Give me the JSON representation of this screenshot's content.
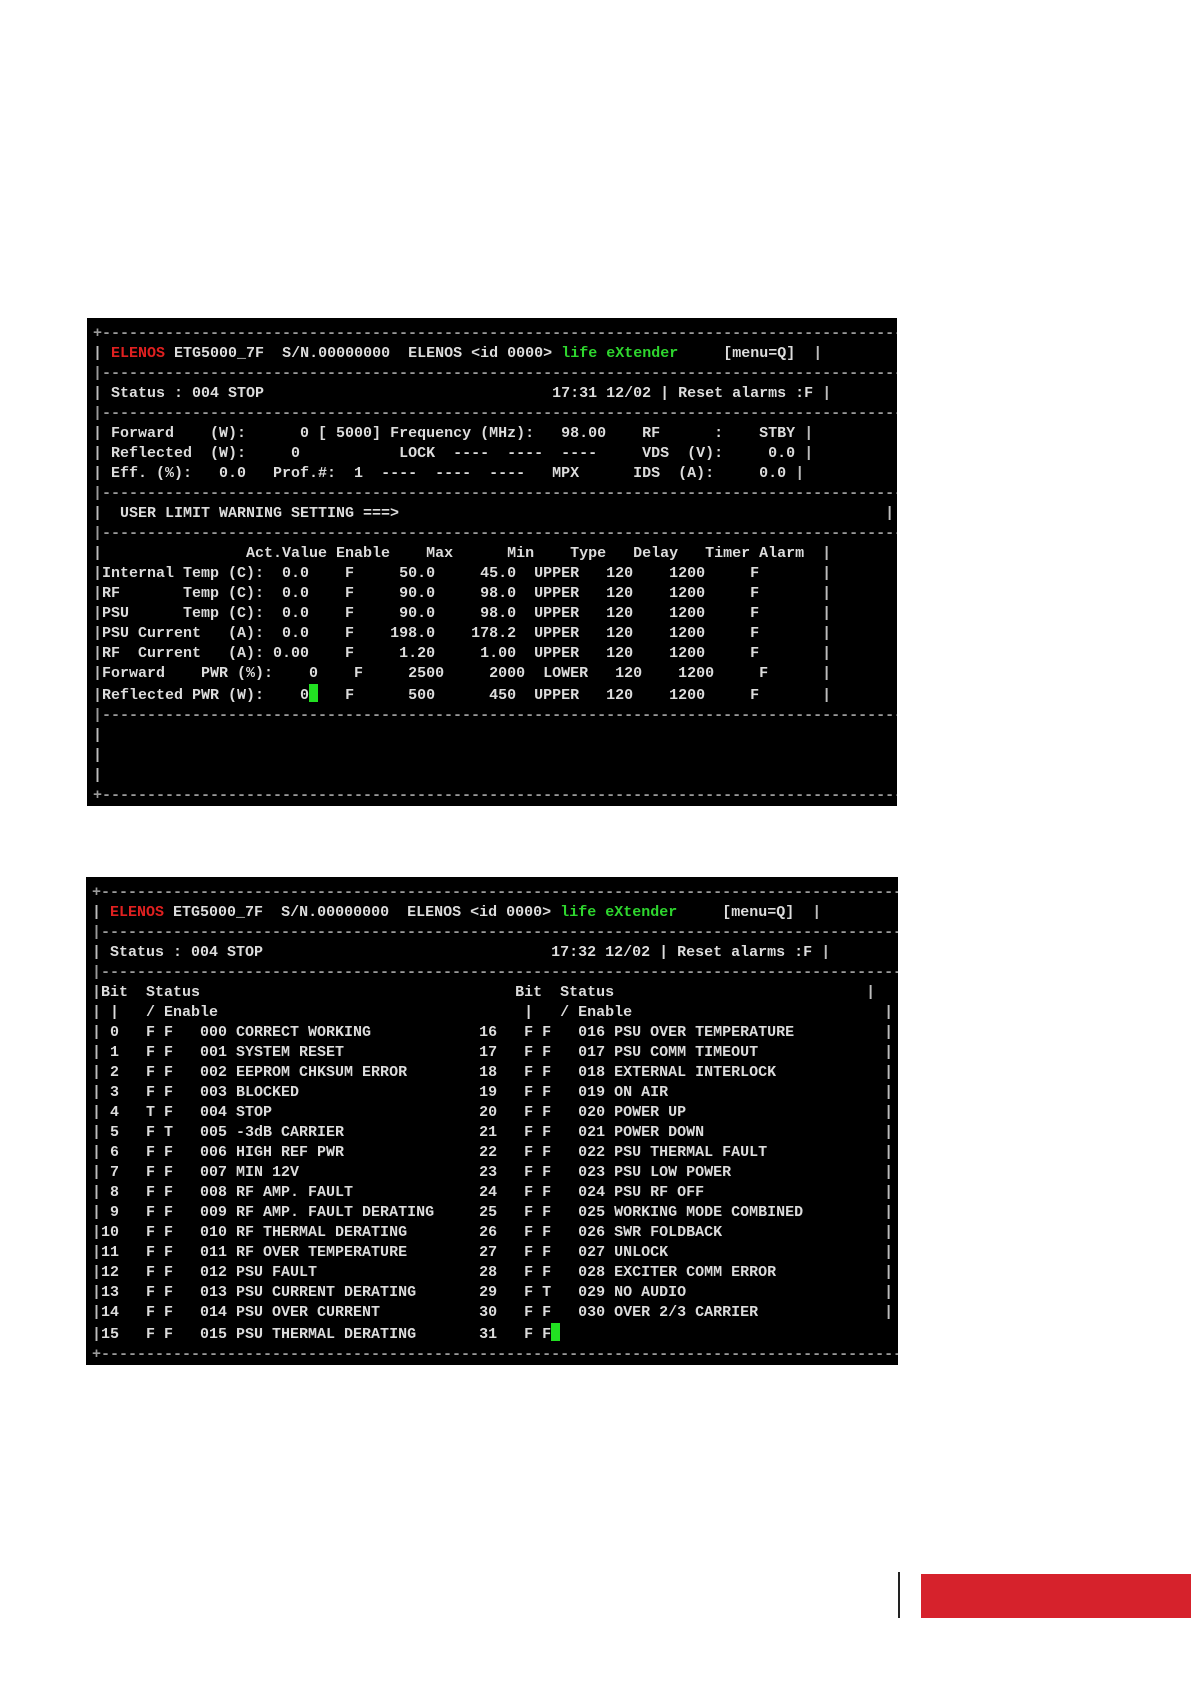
{
  "screen1": {
    "header": {
      "brand": "ELENOS",
      "model": "ETG5000_7F",
      "serial": "S/N.00000000",
      "maker": "ELENOS",
      "id": "<id 0000>",
      "slogan": "life eXtender",
      "menu": "[menu=Q]"
    },
    "status": {
      "label": "Status : 004 STOP",
      "time": "17:31 12/02",
      "reset": "Reset alarms :F"
    },
    "measures": [
      {
        "left": "Forward    (W):      0 [ 5000]",
        "mid": "Frequency (MHz):   98.00",
        "right": "RF      :    STBY"
      },
      {
        "left": "Reflected  (W):     0",
        "mid": "LOCK  ----  ----  ----",
        "right": "VDS  (V):     0.0"
      },
      {
        "left": "Eff. (%):   0.0   Prof.#:  1",
        "mid": "----  ----  ----   MPX",
        "right": "IDS  (A):     0.0"
      }
    ],
    "warning_title": "USER LIMIT WARNING SETTING ===>",
    "table_header": "                Act.Value Enable    Max      Min    Type   Delay   Timer Alarm",
    "rows": [
      "Internal Temp (C):  0.0    F     50.0     45.0  UPPER   120    1200     F",
      "RF       Temp (C):  0.0    F     90.0     98.0  UPPER   120    1200     F",
      "PSU      Temp (C):  0.0    F     90.0     98.0  UPPER   120    1200     F",
      "PSU Current   (A):  0.0    F    198.0    178.2  UPPER   120    1200     F",
      "RF  Current   (A): 0.00    F     1.20     1.00  UPPER   120    1200     F",
      "Forward    PWR (%):    0    F     2500     2000  LOWER   120    1200     F"
    ],
    "last_row_left": "Reflected PWR (W):    0",
    "last_row_right": "F      500      450  UPPER   120    1200     F"
  },
  "screen2": {
    "header": {
      "brand": "ELENOS",
      "model": "ETG5000_7F",
      "serial": "S/N.00000000",
      "maker": "ELENOS",
      "id": "<id 0000>",
      "slogan": "life eXtender",
      "menu": "[menu=Q]"
    },
    "status": {
      "label": "Status : 004 STOP",
      "time": "17:32 12/02",
      "reset": "Reset alarms :F"
    },
    "col_header1": "Bit  Status                                   Bit  Status",
    "col_header2": " |   / Enable                                  |   / Enable",
    "rows": [
      " 0   F F   000 CORRECT WORKING            16   F F   016 PSU OVER TEMPERATURE",
      " 1   F F   001 SYSTEM RESET               17   F F   017 PSU COMM TIMEOUT",
      " 2   F F   002 EEPROM CHKSUM ERROR        18   F F   018 EXTERNAL INTERLOCK",
      " 3   F F   003 BLOCKED                    19   F F   019 ON AIR",
      " 4   T F   004 STOP                       20   F F   020 POWER UP",
      " 5   F T   005 -3dB CARRIER               21   F F   021 POWER DOWN",
      " 6   F F   006 HIGH REF PWR               22   F F   022 PSU THERMAL FAULT",
      " 7   F F   007 MIN 12V                    23   F F   023 PSU LOW POWER",
      " 8   F F   008 RF AMP. FAULT              24   F F   024 PSU RF OFF",
      " 9   F F   009 RF AMP. FAULT DERATING     25   F F   025 WORKING MODE COMBINED",
      "10   F F   010 RF THERMAL DERATING        26   F F   026 SWR FOLDBACK",
      "11   F F   011 RF OVER TEMPERATURE        27   F F   027 UNLOCK",
      "12   F F   012 PSU FAULT                  28   F F   028 EXCITER COMM ERROR",
      "13   F F   013 PSU CURRENT DERATING       29   F T   029 NO AUDIO",
      "14   F F   014 PSU OVER CURRENT           30   F F   030 OVER 2/3 CARRIER"
    ],
    "last_row": "15   F F   015 PSU THERMAL DERATING       31   F F"
  }
}
